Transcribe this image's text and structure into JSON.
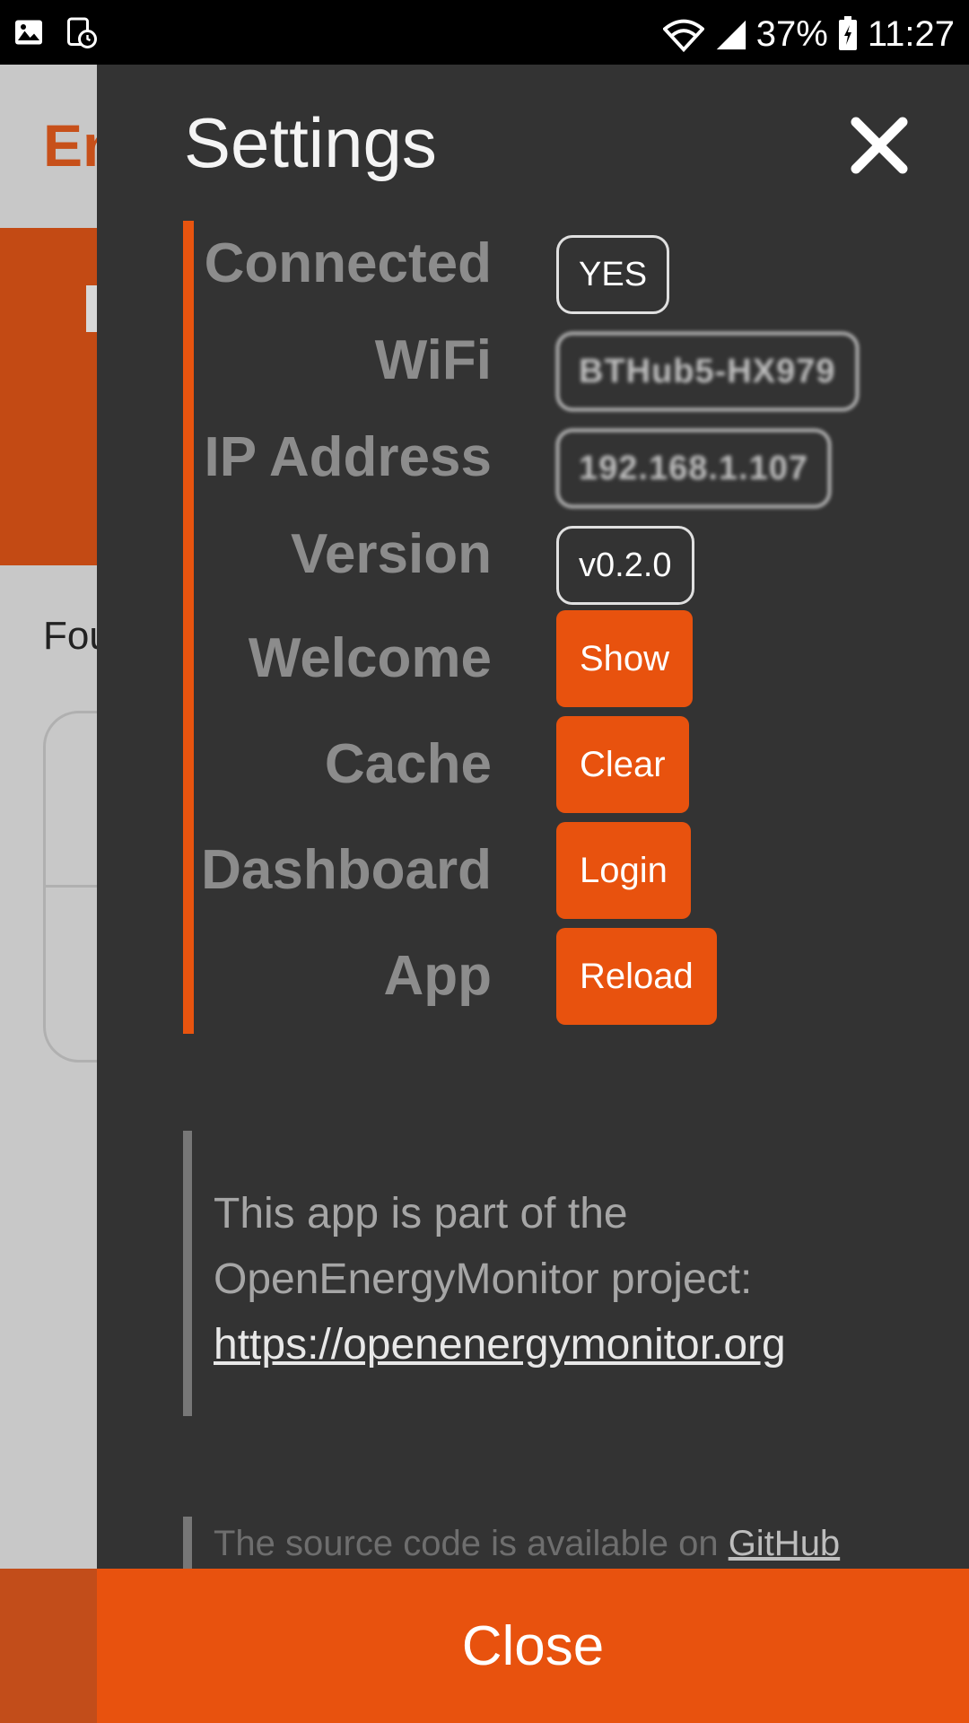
{
  "status_bar": {
    "battery": "37%",
    "time": "11:27",
    "icons": [
      "gallery-icon",
      "alarm-icon",
      "wifi-icon",
      "signal-icon",
      "battery-icon"
    ]
  },
  "background_app": {
    "title_fragment": "En",
    "found_fragment": "Fou"
  },
  "settings": {
    "title": "Settings",
    "rows": [
      {
        "label": "Connected",
        "value": "YES"
      },
      {
        "label": "WiFi",
        "value": "BTHub5-HX979"
      },
      {
        "label": "IP Address",
        "value": "192.168.1.107"
      },
      {
        "label": "Version",
        "value": "v0.2.0"
      },
      {
        "label": "Welcome",
        "button": "Show"
      },
      {
        "label": "Cache",
        "button": "Clear"
      },
      {
        "label": "Dashboard",
        "button": "Login"
      },
      {
        "label": "App",
        "button": "Reload"
      }
    ],
    "info_line1": "This app is part of the",
    "info_line2": "OpenEnergyMonitor project:",
    "info_link": "https://openenergymonitor.org",
    "source_text": "The source code is available on",
    "source_link": "GitHub",
    "close_label": "Close"
  },
  "colors": {
    "accent": "#e8520e",
    "drawer_bg": "#333333",
    "label_gray": "#8c8c8c"
  }
}
